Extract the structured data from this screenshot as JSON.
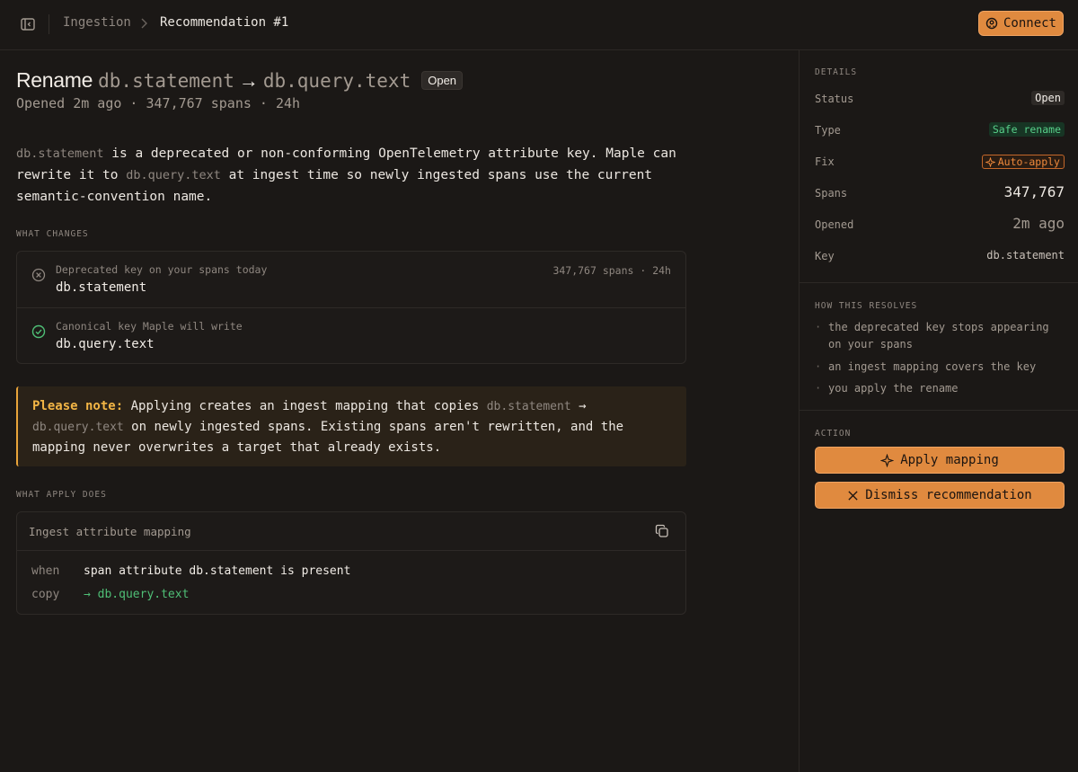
{
  "breadcrumb": {
    "root": "Ingestion",
    "current": "Recommendation #1"
  },
  "header": {
    "connect_label": "Connect"
  },
  "title": {
    "verb": "Rename",
    "from_key": "db.statement",
    "arrow": "→",
    "to_key": "db.query.text",
    "status_badge": "Open"
  },
  "subtitle": "Opened 2m ago · 347,767 spans · 24h",
  "description": {
    "key1": "db.statement",
    "text1": " is a deprecated or non-conforming OpenTelemetry attribute key. Maple can rewrite it to ",
    "key2": "db.query.text",
    "text2": " at ingest time so newly ingested spans use the current semantic-convention name."
  },
  "what_changes": {
    "label": "WHAT CHANGES",
    "rows": [
      {
        "label": "Deprecated key on your spans today",
        "key": "db.statement",
        "meta": "347,767 spans · 24h"
      },
      {
        "label": "Canonical key Maple will write",
        "key": "db.query.text"
      }
    ]
  },
  "note": {
    "strong": "Please note:",
    "text1": " Applying creates an ingest mapping that copies ",
    "key1": "db.statement",
    "arrow": " → ",
    "key2": "db.query.text",
    "text2": " on newly ingested spans. Existing spans aren't rewritten, and the mapping never overwrites a target that already exists."
  },
  "what_apply_does": {
    "label": "WHAT APPLY DOES",
    "box_title": "Ingest attribute mapping",
    "when_kw": "when",
    "when_val": "span attribute db.statement is present",
    "copy_kw": "copy",
    "copy_val": "→ db.query.text"
  },
  "details": {
    "label": "DETAILS",
    "status_key": "Status",
    "status_val": "Open",
    "type_key": "Type",
    "type_val": "Safe rename",
    "fix_key": "Fix",
    "fix_val": "Auto-apply",
    "spans_key": "Spans",
    "spans_val": "347,767",
    "opened_key": "Opened",
    "opened_val": "2m ago",
    "key_key": "Key",
    "key_val": "db.statement"
  },
  "how_resolves": {
    "label": "HOW THIS RESOLVES",
    "items": [
      "the deprecated key stops appearing on your spans",
      "an ingest mapping covers the key",
      "you apply the rename"
    ]
  },
  "action": {
    "label": "ACTION",
    "apply_label": "Apply mapping",
    "dismiss_label": "Dismiss recommendation"
  },
  "colors": {
    "accent": "#e08a3f",
    "success": "#4fbf76",
    "warning": "#f2b545"
  }
}
